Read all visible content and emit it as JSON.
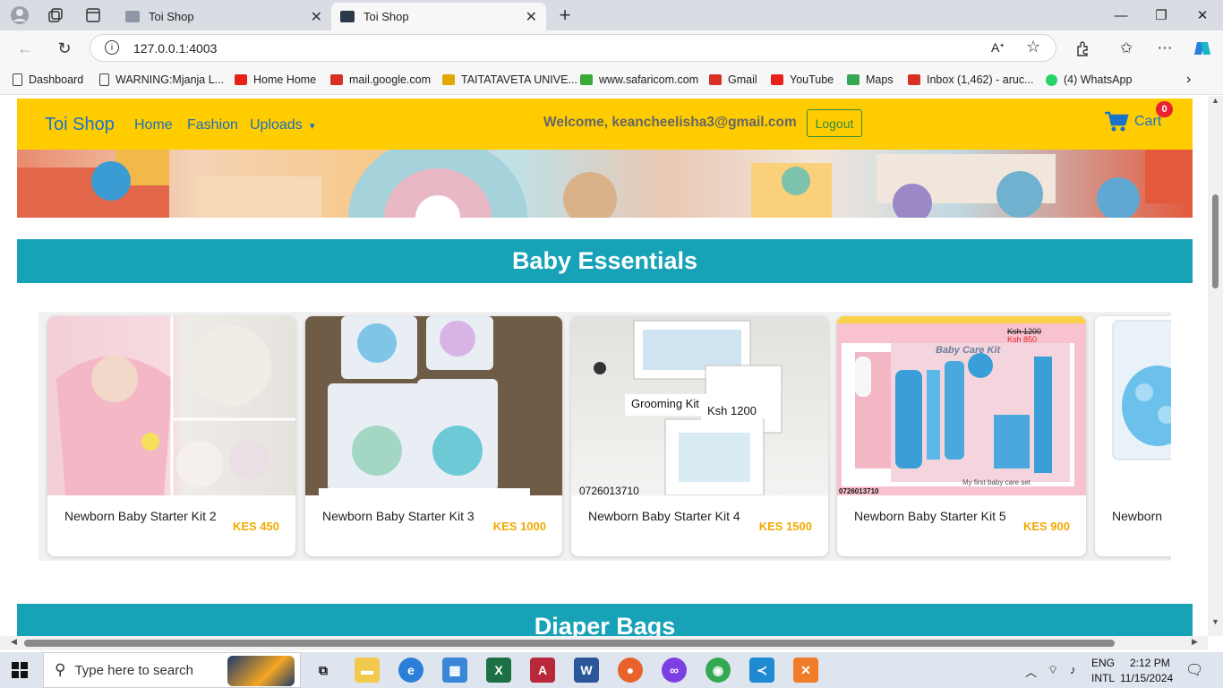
{
  "browser": {
    "tabs": [
      {
        "title": "Toi Shop",
        "active": false
      },
      {
        "title": "Toi Shop",
        "active": true
      }
    ],
    "url": "127.0.0.1:4003",
    "new_tab": "+",
    "bookmarks": [
      {
        "label": "Dashboard",
        "icon": "page-icon",
        "color": "#555555"
      },
      {
        "label": "WARNING:Mjanja L...",
        "icon": "page-icon",
        "color": "#555555"
      },
      {
        "label": "Home Home",
        "icon": "youtube-icon",
        "color": "#e62117"
      },
      {
        "label": "mail.google.com",
        "icon": "gmail-icon",
        "color": "#d93025"
      },
      {
        "label": "TAITATAVETA UNIVE...",
        "icon": "university-icon",
        "color": "#e0a800"
      },
      {
        "label": "www.safaricom.com",
        "icon": "safaricom-icon",
        "color": "#3aa935"
      },
      {
        "label": "Gmail",
        "icon": "gmail-icon",
        "color": "#d93025"
      },
      {
        "label": "YouTube",
        "icon": "youtube-icon",
        "color": "#e62117"
      },
      {
        "label": "Maps",
        "icon": "maps-icon",
        "color": "#34a853"
      },
      {
        "label": "Inbox (1,462) - aruc...",
        "icon": "gmail-icon",
        "color": "#d93025"
      },
      {
        "label": "(4) WhatsApp",
        "icon": "whatsapp-icon",
        "color": "#25d366"
      }
    ]
  },
  "nav": {
    "brand": "Toi Shop",
    "links": [
      "Home",
      "Fashion",
      "Uploads"
    ],
    "welcome": "Welcome, keancheelisha3@gmail.com",
    "logout": "Logout",
    "cart": "Cart",
    "cart_count": "0",
    "bg_color": "#ffcc00",
    "link_color": "#1a6fc0"
  },
  "sections": {
    "baby_essentials": "Baby Essentials",
    "diaper_bags": "Diaper Bags"
  },
  "products": [
    {
      "name": "Newborn Baby Starter Kit 2",
      "price": "KES 450"
    },
    {
      "name": "Newborn Baby Starter Kit 3",
      "price": "KES 1000"
    },
    {
      "name": "Newborn Baby Starter Kit 4",
      "price": "KES 1500",
      "overlay_title": "Grooming Kit",
      "overlay_price": "Ksh 1200",
      "overlay_phone": "0726013710"
    },
    {
      "name": "Newborn Baby Starter Kit 5",
      "price": "KES 900",
      "overlay_old": "Ksh 1200",
      "overlay_new": "Ksh 850",
      "overlay_brand": "Baby Care Kit",
      "overlay_phone": "0726013710",
      "overlay_caption": "My first baby care set"
    },
    {
      "name": "Newborn",
      "price": ""
    }
  ],
  "taskbar": {
    "search_placeholder": "Type here to search",
    "lang": "ENG",
    "layout": "INTL",
    "time": "2:12 PM",
    "date": "11/15/2024"
  }
}
